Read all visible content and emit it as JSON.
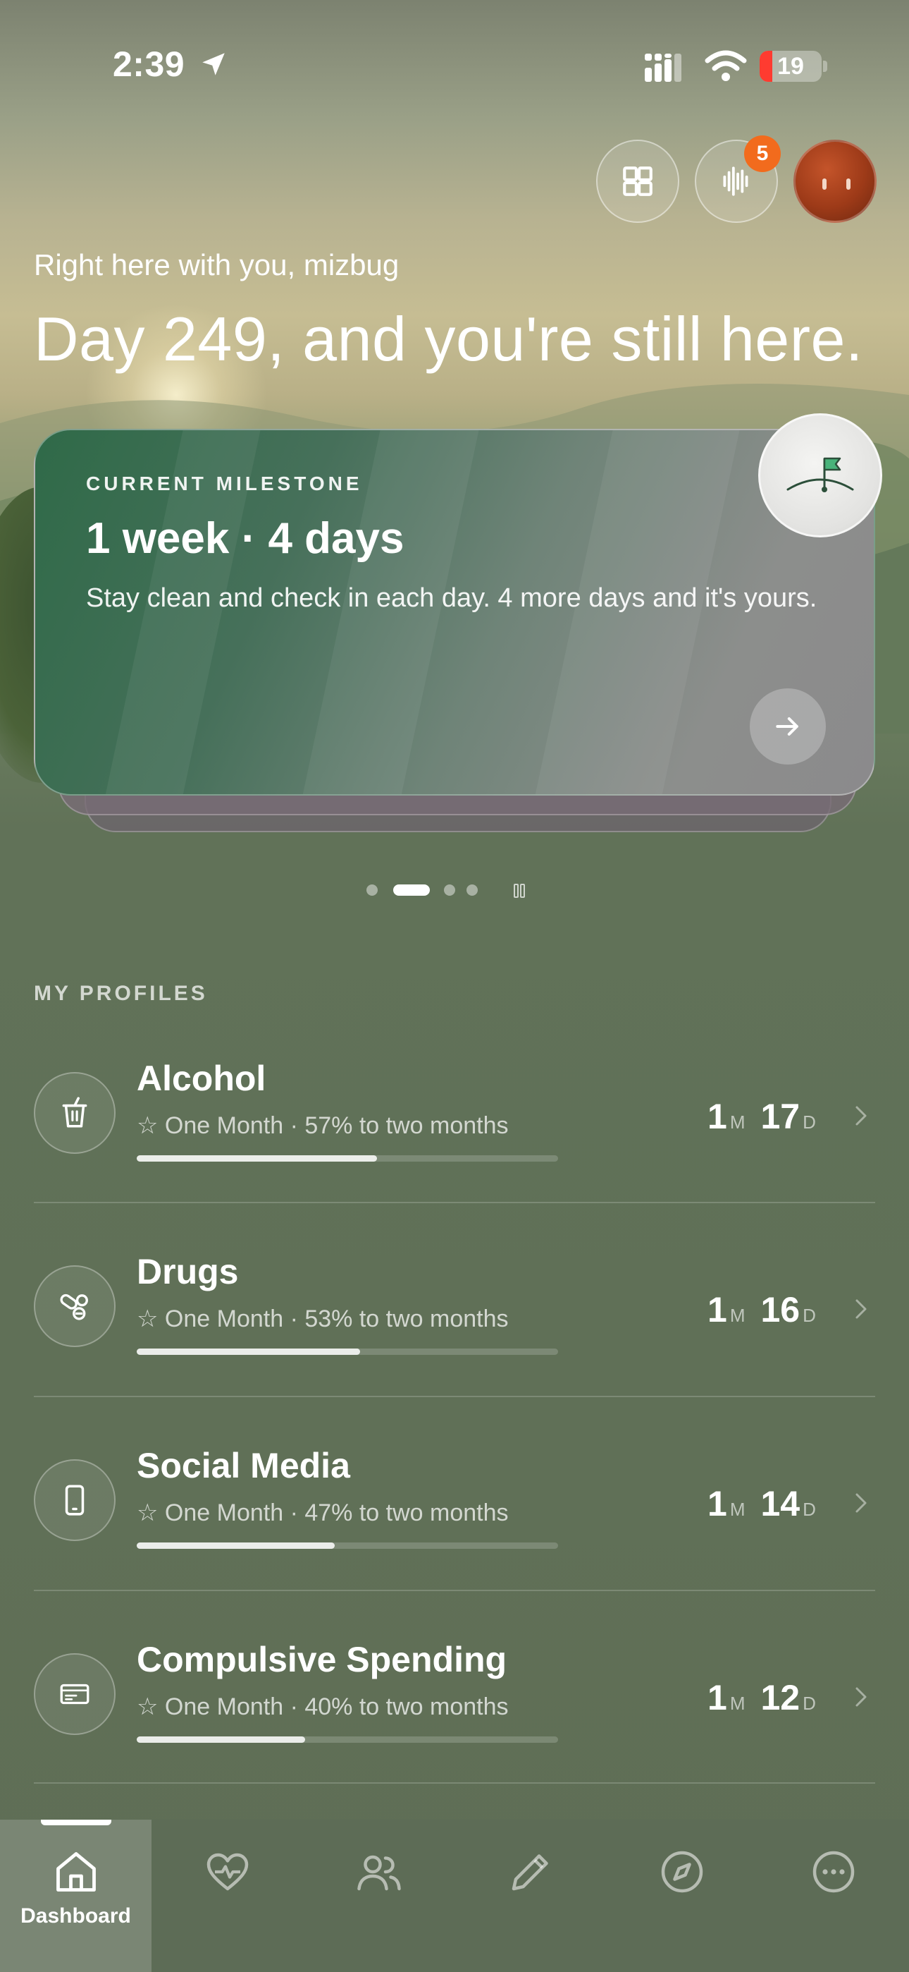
{
  "status_bar": {
    "time": "2:39",
    "battery_level": "19",
    "icons": [
      "location-arrow-icon",
      "signal-icon",
      "wifi-icon",
      "battery-icon"
    ]
  },
  "header": {
    "buttons": [
      "widgets-grid-icon",
      "voice-waveform-icon"
    ],
    "notification_count": "5",
    "avatar": "profile-avatar"
  },
  "greeting": {
    "subtitle": "Right here with you, mizbug",
    "title": "Day 249, and you're still here."
  },
  "milestone": {
    "eyebrow": "CURRENT MILESTONE",
    "title": "1 week · 4 days",
    "description": "Stay clean and check in each day. 4 more days and it's yours.",
    "badge_icon": "golf-flag-icon",
    "arrow_icon": "arrow-right-icon"
  },
  "pager": {
    "count": 4,
    "active_index": 1,
    "pause_icon": "pause-icon"
  },
  "profiles": {
    "section_label": "MY PROFILES",
    "items": [
      {
        "name": "Alcohol",
        "icon": "cup-icon",
        "subtitle": "☆ One Month · 57% to two months",
        "progress": 0.57,
        "months": "1",
        "month_unit": "M",
        "days": "17",
        "day_unit": "D"
      },
      {
        "name": "Drugs",
        "icon": "pills-icon",
        "subtitle": "☆ One Month · 53% to two months",
        "progress": 0.53,
        "months": "1",
        "month_unit": "M",
        "days": "16",
        "day_unit": "D"
      },
      {
        "name": "Social Media",
        "icon": "phone-icon",
        "subtitle": "☆ One Month · 47% to two months",
        "progress": 0.47,
        "months": "1",
        "month_unit": "M",
        "days": "14",
        "day_unit": "D"
      },
      {
        "name": "Compulsive Spending",
        "icon": "cash-icon",
        "subtitle": "☆ One Month · 40% to two months",
        "progress": 0.4,
        "months": "1",
        "month_unit": "M",
        "days": "12",
        "day_unit": "D"
      }
    ]
  },
  "tab_bar": {
    "active": "Dashboard",
    "tabs": [
      {
        "label": "Dashboard",
        "icon": "home-icon"
      },
      {
        "label": "",
        "icon": "heart-pulse-icon"
      },
      {
        "label": "",
        "icon": "people-icon"
      },
      {
        "label": "",
        "icon": "pencil-icon"
      },
      {
        "label": "",
        "icon": "compass-icon"
      },
      {
        "label": "",
        "icon": "more-icon"
      }
    ]
  }
}
